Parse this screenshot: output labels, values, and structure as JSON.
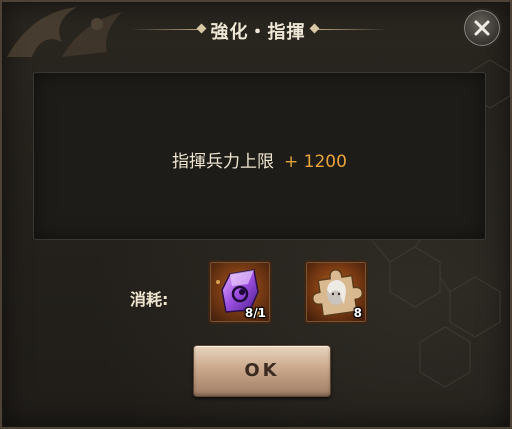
{
  "dialog": {
    "title": "強化・指揮",
    "close_icon": "close-icon"
  },
  "bonus": {
    "label": "指揮兵力上限",
    "value": "+ 1200"
  },
  "cost": {
    "label": "消耗:",
    "items": [
      {
        "icon": "purple-crystal-icon",
        "count": "8/1"
      },
      {
        "icon": "hero-puzzle-piece-icon",
        "count": "8"
      }
    ]
  },
  "actions": {
    "ok_label": "OK"
  },
  "colors": {
    "bonus_value": "#e8a33a",
    "title_text": "#efe7d6",
    "ok_button": "#caa88c"
  }
}
